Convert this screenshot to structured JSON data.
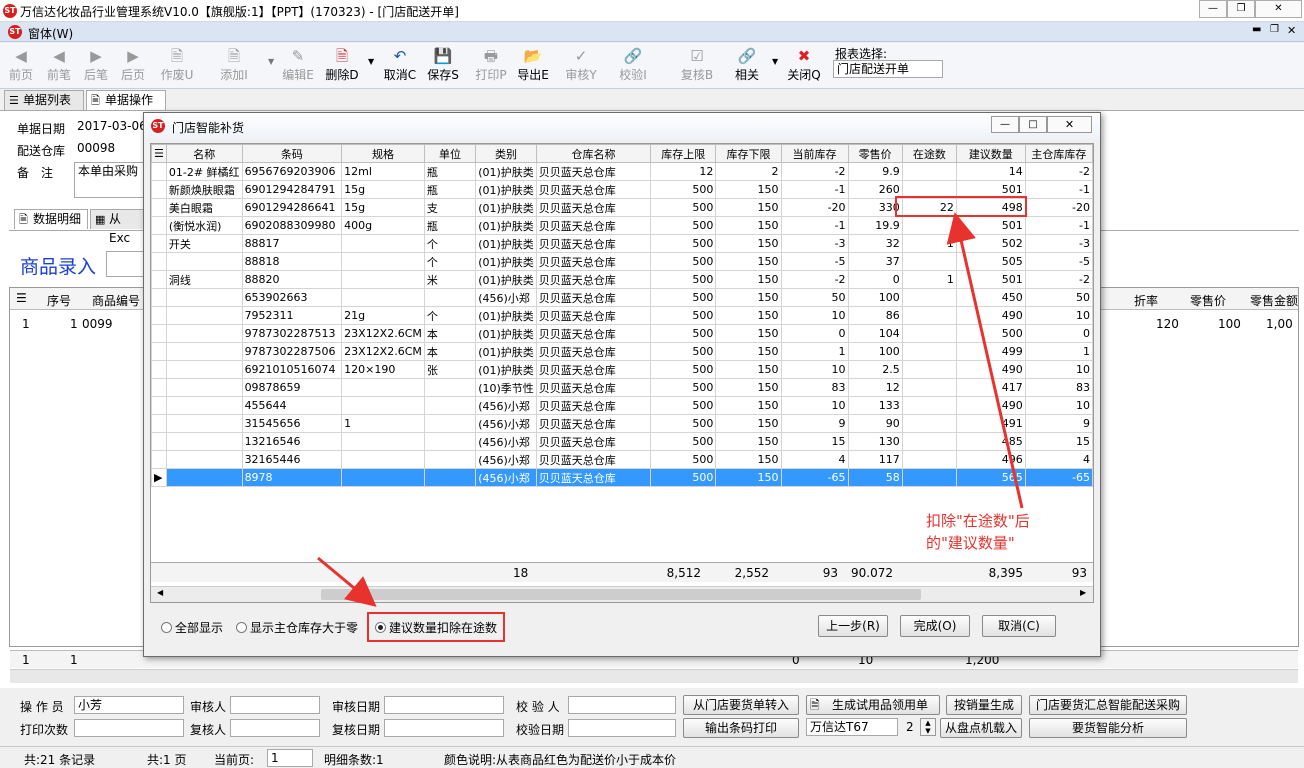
{
  "app": {
    "title": "万信达化妆品行业管理系统V10.0【旗舰版:1】【PPT】(170323) - [门店配送开单]",
    "menu": "窗体(W)"
  },
  "toolbar": {
    "buttons": [
      {
        "label": "前页",
        "icon": "first-icon",
        "enabled": false
      },
      {
        "label": "前笔",
        "icon": "prev-icon",
        "enabled": false
      },
      {
        "label": "后笔",
        "icon": "next-icon",
        "enabled": false
      },
      {
        "label": "后页",
        "icon": "last-icon",
        "enabled": false
      },
      {
        "label": "作废U",
        "icon": "void-icon",
        "enabled": false
      },
      {
        "label": "添加I",
        "icon": "add-icon",
        "enabled": false
      },
      {
        "label": "编辑E",
        "icon": "edit-icon",
        "enabled": false
      },
      {
        "label": "删除D",
        "icon": "delete-icon",
        "enabled": true
      },
      {
        "label": "取消C",
        "icon": "undo-icon",
        "enabled": true
      },
      {
        "label": "保存S",
        "icon": "save-icon",
        "enabled": true
      },
      {
        "label": "打印P",
        "icon": "print-icon",
        "enabled": false
      },
      {
        "label": "导出E",
        "icon": "export-icon",
        "enabled": true
      },
      {
        "label": "审核Y",
        "icon": "audit-icon",
        "enabled": false
      },
      {
        "label": "校验I",
        "icon": "verify-icon",
        "enabled": false
      },
      {
        "label": "复核B",
        "icon": "recheck-icon",
        "enabled": false
      },
      {
        "label": "相关",
        "icon": "related-icon",
        "enabled": true
      },
      {
        "label": "关闭Q",
        "icon": "close-icon",
        "enabled": true
      }
    ],
    "report_label": "报表选择:",
    "report_value": "门店配送开单"
  },
  "tabs": [
    "单据列表",
    "单据操作"
  ],
  "form": {
    "date_label": "单据日期",
    "date_value": "2017-03-06",
    "store_label": "配送仓库",
    "store_value": "00098",
    "remark_label": "备　注",
    "remark_value": "本单由采购"
  },
  "subtabs": [
    "数据明细",
    "从Exc"
  ],
  "entry_label": "商品录入",
  "bgrid": {
    "headers": [
      "序号",
      "商品编号"
    ],
    "right_headers": [
      "折率",
      "零售价",
      "零售金额"
    ],
    "row": {
      "idx": "1",
      "seq": "1",
      "code": "0099",
      "rate": "120",
      "price": "100",
      "amount": "1,00"
    },
    "footer_left": "1",
    "footer_mid": "1",
    "footer_vals": [
      "0",
      "10",
      "1,200"
    ]
  },
  "bottom": {
    "operator_label": "操 作 员",
    "operator_value": "小芳",
    "auditor_label": "审核人",
    "audit_date_label": "审核日期",
    "verifier_label": "校 验 人",
    "print_count_label": "打印次数",
    "rechecker_label": "复核人",
    "recheck_date_label": "复核日期",
    "verify_date_label": "校验日期",
    "buttons": {
      "from_store": "从门店要货单转入",
      "trial_requisition": "生成试用品领用单",
      "by_sales": "按销量生成",
      "summary": "门店要货汇总智能配送采购",
      "print_barcode": "输出条码打印",
      "printer": "万信达T67",
      "copies": "2",
      "from_stock": "从盘点机载入",
      "smart_analysis": "要货智能分析"
    }
  },
  "status": {
    "records": "共:21 条记录",
    "pages": "共:1 页",
    "current_page_label": "当前页:",
    "current_page": "1",
    "detail_count": "明细条数:1",
    "color_note": "颜色说明:从表商品红色为配送价小于成本价"
  },
  "dialog": {
    "title": "门店智能补货",
    "headers": [
      "名称",
      "条码",
      "规格",
      "单位",
      "类别",
      "仓库名称",
      "库存上限",
      "库存下限",
      "当前库存",
      "零售价",
      "在途数",
      "建议数量",
      "主仓库库存"
    ],
    "rows": [
      [
        "01-2# 鲜橘红",
        "6956769203906",
        "12ml",
        "瓶",
        "(01)护肤类",
        "贝贝蓝天总仓库",
        "12",
        "2",
        "-2",
        "9.9",
        "",
        "14",
        "-2"
      ],
      [
        "新颜焕肤眼霜",
        "6901294284791",
        "15g",
        "瓶",
        "(01)护肤类",
        "贝贝蓝天总仓库",
        "500",
        "150",
        "-1",
        "260",
        "",
        "501",
        "-1"
      ],
      [
        "美白眼霜",
        "6901294286641",
        "15g",
        "支",
        "(01)护肤类",
        "贝贝蓝天总仓库",
        "500",
        "150",
        "-20",
        "330",
        "22",
        "498",
        "-20"
      ],
      [
        "(衡悦水润)",
        "6902088309980",
        "400g",
        "瓶",
        "(01)护肤类",
        "贝贝蓝天总仓库",
        "500",
        "150",
        "-1",
        "19.9",
        "",
        "501",
        "-1"
      ],
      [
        "开关",
        "88817",
        "",
        "个",
        "(01)护肤类",
        "贝贝蓝天总仓库",
        "500",
        "150",
        "-3",
        "32",
        "1",
        "502",
        "-3"
      ],
      [
        "",
        "88818",
        "",
        "个",
        "(01)护肤类",
        "贝贝蓝天总仓库",
        "500",
        "150",
        "-5",
        "37",
        "",
        "505",
        "-5"
      ],
      [
        "洞线",
        "88820",
        "",
        "米",
        "(01)护肤类",
        "贝贝蓝天总仓库",
        "500",
        "150",
        "-2",
        "0",
        "1",
        "501",
        "-2"
      ],
      [
        "",
        "653902663",
        "",
        "",
        "(456)小郑",
        "贝贝蓝天总仓库",
        "500",
        "150",
        "50",
        "100",
        "",
        "450",
        "50"
      ],
      [
        "",
        "7952311",
        "21g",
        "个",
        "(01)护肤类",
        "贝贝蓝天总仓库",
        "500",
        "150",
        "10",
        "86",
        "",
        "490",
        "10"
      ],
      [
        "",
        "9787302287513",
        "23X12X2.6CM",
        "本",
        "(01)护肤类",
        "贝贝蓝天总仓库",
        "500",
        "150",
        "0",
        "104",
        "",
        "500",
        "0"
      ],
      [
        "",
        "9787302287506",
        "23X12X2.6CM",
        "本",
        "(01)护肤类",
        "贝贝蓝天总仓库",
        "500",
        "150",
        "1",
        "100",
        "",
        "499",
        "1"
      ],
      [
        "",
        "6921010516074",
        "120×190",
        "张",
        "(01)护肤类",
        "贝贝蓝天总仓库",
        "500",
        "150",
        "10",
        "2.5",
        "",
        "490",
        "10"
      ],
      [
        "",
        "09878659",
        "",
        "",
        "(10)季节性",
        "贝贝蓝天总仓库",
        "500",
        "150",
        "83",
        "12",
        "",
        "417",
        "83"
      ],
      [
        "",
        "455644",
        "",
        "",
        "(456)小郑",
        "贝贝蓝天总仓库",
        "500",
        "150",
        "10",
        "133",
        "",
        "490",
        "10"
      ],
      [
        "",
        "31545656",
        "1",
        "",
        "(456)小郑",
        "贝贝蓝天总仓库",
        "500",
        "150",
        "9",
        "90",
        "",
        "491",
        "9"
      ],
      [
        "",
        "13216546",
        "",
        "",
        "(456)小郑",
        "贝贝蓝天总仓库",
        "500",
        "150",
        "15",
        "130",
        "",
        "485",
        "15"
      ],
      [
        "",
        "32165446",
        "",
        "",
        "(456)小郑",
        "贝贝蓝天总仓库",
        "500",
        "150",
        "4",
        "117",
        "",
        "496",
        "4"
      ],
      [
        "",
        "8978",
        "",
        "",
        "(456)小郑",
        "贝贝蓝天总仓库",
        "500",
        "150",
        "-65",
        "58",
        "",
        "565",
        "-65"
      ]
    ],
    "totals": [
      "18",
      "8,512",
      "2,552",
      "93",
      "90.072",
      "",
      "8,395",
      "93"
    ],
    "radios": [
      "全部显示",
      "显示主仓库存大于零",
      "建议数量扣除在途数"
    ],
    "selected_radio": 2,
    "buttons": [
      "上一步(R)",
      "完成(O)",
      "取消(C)"
    ]
  },
  "annotation": {
    "line1": "扣除\"在途数\"后",
    "line2": "的\"建议数量\""
  },
  "colors": {
    "accent_red": "#e8322d",
    "selection": "#3399ff",
    "entry_blue": "#1a3fd6"
  }
}
